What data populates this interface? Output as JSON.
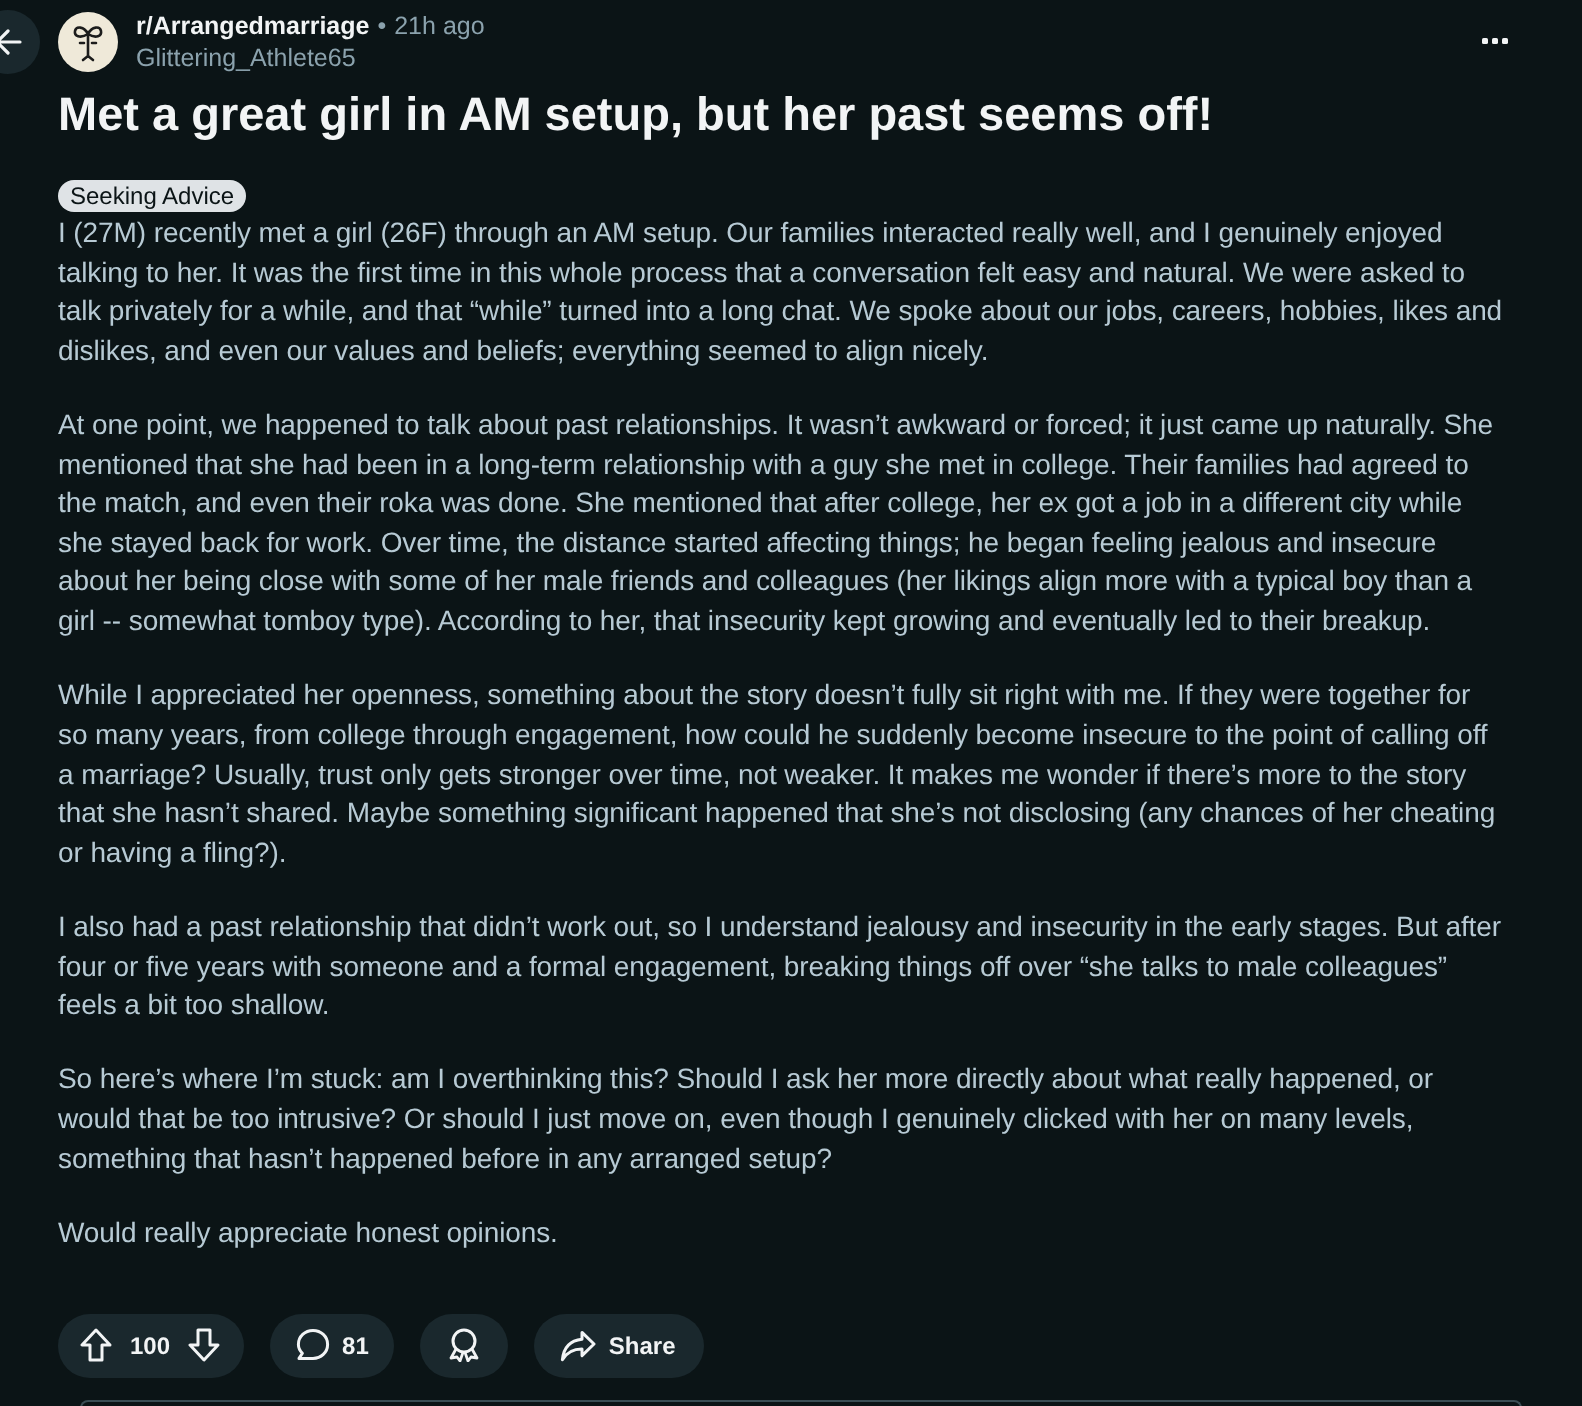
{
  "header": {
    "subreddit": "r/Arrangedmarriage",
    "separator": "•",
    "time": "21h ago",
    "author": "Glittering_Athlete65"
  },
  "post": {
    "title": "Met a great girl in AM setup, but her past seems off!",
    "flair": "Seeking Advice",
    "paragraphs": [
      "I (27M) recently met a girl (26F) through an AM setup. Our families interacted really well, and I genuinely enjoyed talking to her. It was the first time in this whole process that a conversation felt easy and natural. We were asked to talk privately for a while, and that “while” turned into a long chat. We spoke about our jobs, careers, hobbies, likes and dislikes, and even our values and beliefs; everything seemed to align nicely.",
      "At one point, we happened to talk about past relationships. It wasn’t awkward or forced; it just came up naturally. She mentioned that she had been in a long-term relationship with a guy she met in college. Their families had agreed to the match, and even their roka was done. She mentioned that after college, her ex got a job in a different city while she stayed back for work. Over time, the distance started affecting things; he began feeling jealous and insecure about her being close with some of her male friends and colleagues (her likings align more with a typical boy than a girl -- somewhat tomboy type). According to her, that insecurity kept growing and eventually led to their breakup.",
      "While I appreciated her openness, something about the story doesn’t fully sit right with me. If they were together for so many years, from college through engagement, how could he suddenly become insecure to the point of calling off a marriage? Usually, trust only gets stronger over time, not weaker. It makes me wonder if there’s more to the story that she hasn’t shared. Maybe something significant happened that she’s not disclosing (any chances of her cheating or having a fling?).",
      "I also had a past relationship that didn’t work out, so I understand jealousy and insecurity in the early stages. But after four or five years with someone and a formal engagement, breaking things off over “she talks to male colleagues” feels a bit too shallow.",
      "So here’s where I’m stuck: am I overthinking this? Should I ask her more directly about what really happened, or would that be too intrusive? Or should I just move on, even though I genuinely clicked with her on many levels, something that hasn’t happened before in any arranged setup?",
      "Would really appreciate honest opinions."
    ]
  },
  "actions": {
    "score": "100",
    "comments": "81",
    "share": "Share"
  }
}
